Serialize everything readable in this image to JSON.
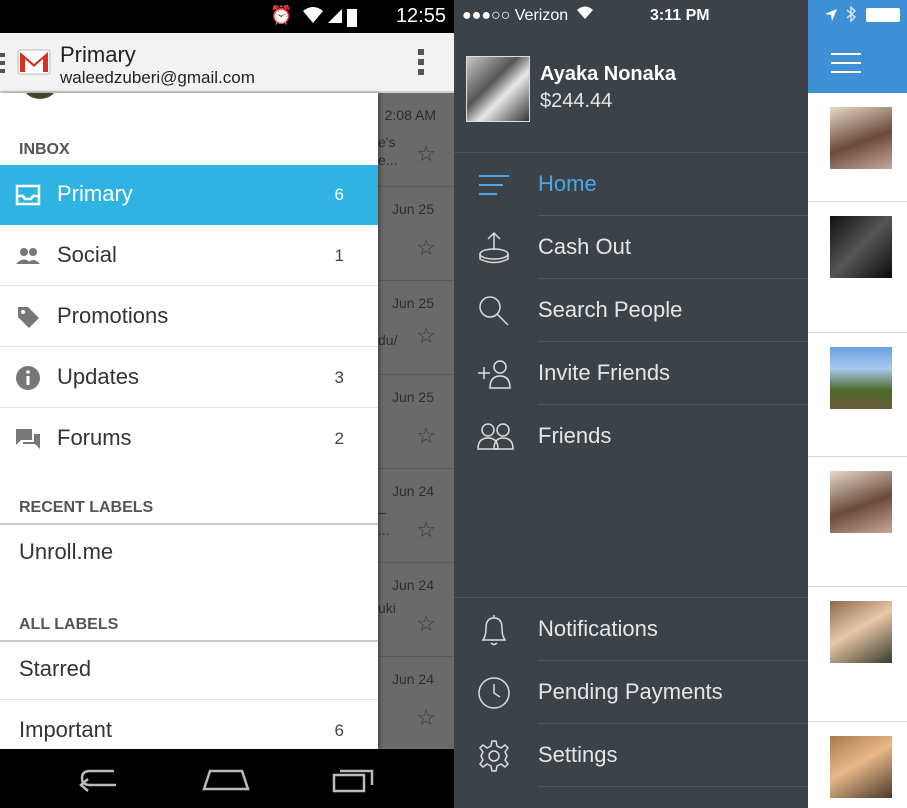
{
  "android": {
    "status_bar": {
      "time": "12:55"
    },
    "action_bar": {
      "title": "Primary",
      "account": "waleedzuberi@gmail.com"
    },
    "drawer": {
      "inbox_header": "INBOX",
      "inbox_items": [
        {
          "label": "Primary",
          "count": "6",
          "icon": "inbox-icon",
          "active": true
        },
        {
          "label": "Social",
          "count": "1",
          "icon": "people-icon"
        },
        {
          "label": "Promotions",
          "count": "",
          "icon": "tag-icon"
        },
        {
          "label": "Updates",
          "count": "3",
          "icon": "info-icon"
        },
        {
          "label": "Forums",
          "count": "2",
          "icon": "forum-icon"
        }
      ],
      "recent_header": "RECENT LABELS",
      "recent_items": [
        {
          "label": "Unroll.me"
        }
      ],
      "all_header": "ALL LABELS",
      "all_items": [
        {
          "label": "Starred",
          "count": ""
        },
        {
          "label": "Important",
          "count": "6"
        }
      ]
    },
    "mail_list": [
      {
        "date": "2:08 AM",
        "snippet": "e's\ne..."
      },
      {
        "date": "Jun 25",
        "snippet": ""
      },
      {
        "date": "Jun 25",
        "snippet": "du/"
      },
      {
        "date": "Jun 25",
        "snippet": ""
      },
      {
        "date": "Jun 24",
        "snippet": "–\n..."
      },
      {
        "date": "Jun 24",
        "snippet": "uki"
      },
      {
        "date": "Jun 24",
        "snippet": ""
      }
    ],
    "colors": {
      "accent": "#2fb3e2",
      "status_bar": "#000000",
      "action_bar": "#f2f2f2"
    }
  },
  "ios": {
    "status_bar": {
      "carrier": "●●●○○ Verizon",
      "time": "3:11 PM"
    },
    "profile": {
      "name": "Ayaka Nonaka",
      "balance": "$244.44"
    },
    "menu": [
      {
        "label": "Home",
        "icon": "home-lines-icon"
      },
      {
        "label": "Cash Out",
        "icon": "cash-out-icon"
      },
      {
        "label": "Search People",
        "icon": "search-icon"
      },
      {
        "label": "Invite Friends",
        "icon": "add-person-icon"
      },
      {
        "label": "Friends",
        "icon": "friends-icon"
      }
    ],
    "bottom_menu": [
      {
        "label": "Notifications",
        "icon": "bell-icon"
      },
      {
        "label": "Pending Payments",
        "icon": "clock-icon"
      },
      {
        "label": "Settings",
        "icon": "gear-icon"
      }
    ],
    "colors": {
      "menu_bg": "#3b4248",
      "highlight": "#4ea6e6",
      "header_blue": "#3f8fd4"
    }
  }
}
